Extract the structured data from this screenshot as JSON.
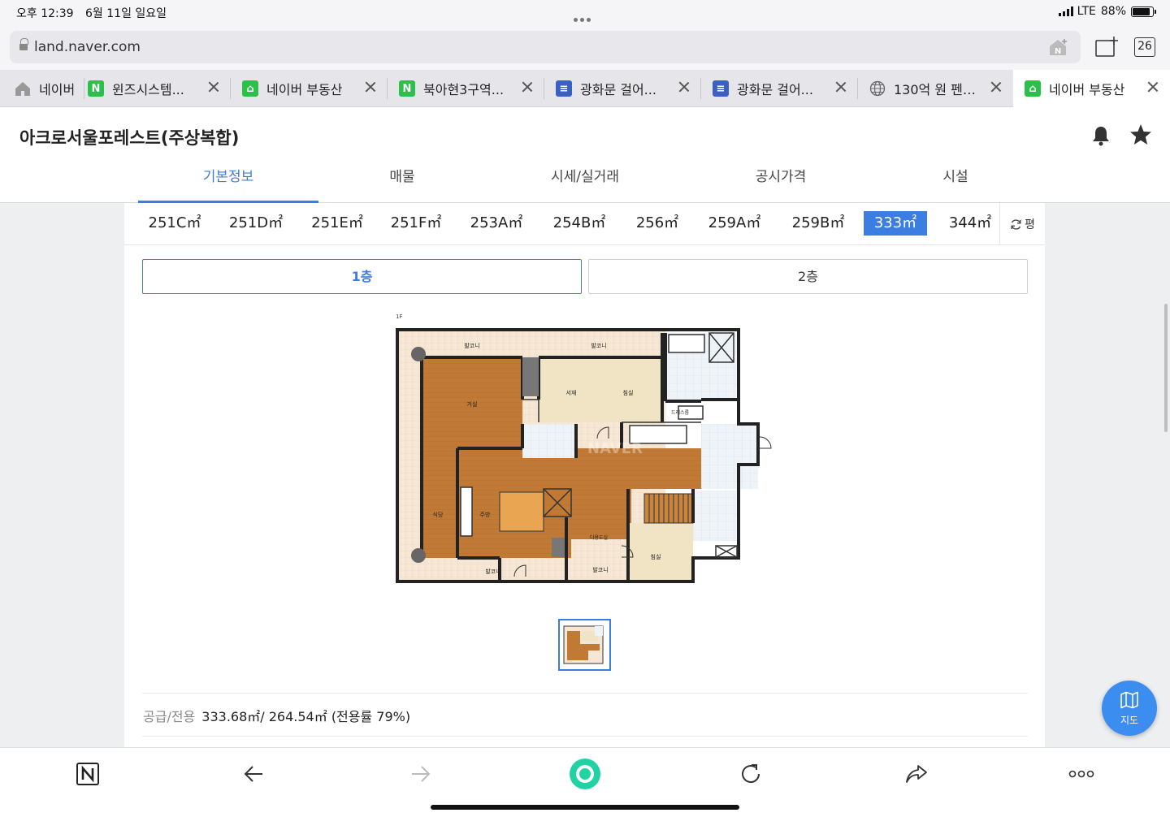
{
  "status": {
    "time": "오후 12:39",
    "date": "6월 11일 일요일",
    "network": "LTE",
    "battery": "88%",
    "battery_level": 0.88
  },
  "browser": {
    "url": "land.naver.com",
    "tab_count": "26",
    "tabs": [
      {
        "label": "네이버",
        "icon": "home-icon"
      },
      {
        "label": "윈즈시스템...",
        "icon": "naver-n-icon"
      },
      {
        "label": "네이버 부동산",
        "icon": "naver-land-icon"
      },
      {
        "label": "북아현3구역...",
        "icon": "naver-n-icon"
      },
      {
        "label": "광화문 걸어...",
        "icon": "document-icon"
      },
      {
        "label": "광화문 걸어...",
        "icon": "document-icon"
      },
      {
        "label": "130억 원 펜…",
        "icon": "globe-icon"
      },
      {
        "label": "네이버 부동산",
        "icon": "naver-land-icon"
      }
    ]
  },
  "page": {
    "title": "아크로서울포레스트(주상복합)",
    "nav_tabs": [
      "기본정보",
      "매물",
      "시세/실거래",
      "공시가격",
      "시설"
    ],
    "active_nav": 0,
    "areas": [
      "251C㎡",
      "251D㎡",
      "251E㎡",
      "251F㎡",
      "253A㎡",
      "254B㎡",
      "256㎡",
      "259A㎡",
      "259B㎡",
      "333㎡",
      "344㎡"
    ],
    "active_area": 9,
    "unit_toggle": "평",
    "floors": [
      "1층",
      "2층"
    ],
    "active_floor": 0,
    "plan_labels": {
      "floor": "1F",
      "balcony": "발코니",
      "study": "서재",
      "bedroom": "침실",
      "living": "거실",
      "dress": "드레스룸",
      "dining": "식당",
      "kitchen": "주방",
      "multi": "다용도실",
      "watermark": "NAVER"
    },
    "supply_label": "공급/전용",
    "supply_value": "333.68㎡/ 264.54㎡ (전용률 79%)",
    "map_button": "지도"
  }
}
